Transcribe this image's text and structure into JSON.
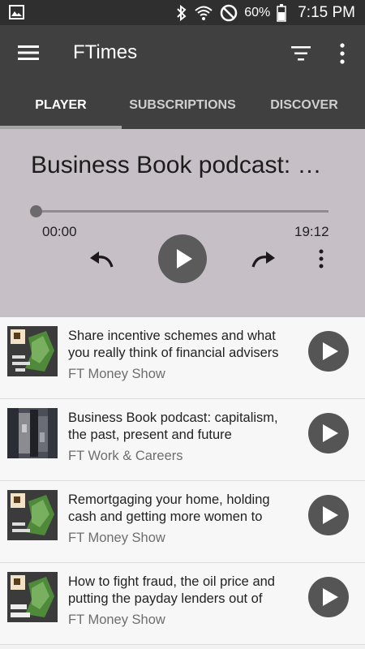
{
  "status_bar": {
    "battery_percent": "60%",
    "time": "7:15 PM",
    "icons": [
      "gallery-icon",
      "bluetooth-icon",
      "wifi-icon",
      "do-not-disturb-icon",
      "battery-icon"
    ]
  },
  "app_bar": {
    "title": "FTimes",
    "icons": [
      "hamburger-menu-icon",
      "filter-icon",
      "overflow-menu-icon"
    ]
  },
  "tabs": [
    {
      "label": "PLAYER",
      "active": true
    },
    {
      "label": "SUBSCRIPTIONS",
      "active": false
    },
    {
      "label": "DISCOVER",
      "active": false
    }
  ],
  "player": {
    "title": "Business Book podcast: …",
    "current_time": "00:00",
    "total_time": "19:12",
    "progress": 0
  },
  "episodes": [
    {
      "title": "Share incentive schemes and what you really think of financial advisers",
      "show": "FT Money Show"
    },
    {
      "title": "Business Book podcast: capitalism, the past, present and future",
      "show": "FT Work & Careers"
    },
    {
      "title": "Remortgaging your home, holding cash and getting more women to",
      "show": "FT Money Show"
    },
    {
      "title": "How to fight fraud, the oil price and putting the payday lenders out of",
      "show": "FT Money Show"
    }
  ],
  "colors": {
    "status_bar": "#2f2f2f",
    "app_bar": "#404040",
    "player_bg": "#c6bfc6",
    "play_button": "#5b5b5b"
  }
}
